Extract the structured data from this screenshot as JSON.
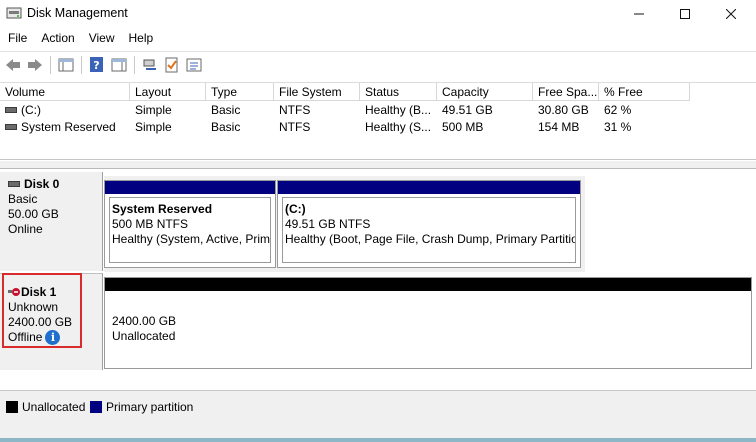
{
  "window": {
    "title": "Disk Management"
  },
  "menu": [
    "File",
    "Action",
    "View",
    "Help"
  ],
  "toolbar": {
    "buttons": [
      "back-icon",
      "forward-icon",
      "console-tree-icon",
      "help-icon",
      "action-pane-icon",
      "connect-icon",
      "check-icon",
      "properties-icon"
    ]
  },
  "volume_table": {
    "columns": [
      "Volume",
      "Layout",
      "Type",
      "File System",
      "Status",
      "Capacity",
      "Free Spa...",
      "% Free"
    ],
    "rows": [
      [
        "(C:)",
        "Simple",
        "Basic",
        "NTFS",
        "Healthy (B...",
        "49.51 GB",
        "30.80 GB",
        "62 %"
      ],
      [
        "System Reserved",
        "Simple",
        "Basic",
        "NTFS",
        "Healthy (S...",
        "500 MB",
        "154 MB",
        "31 %"
      ]
    ]
  },
  "disks": [
    {
      "name": "Disk 0",
      "type": "Basic",
      "size": "50.00 GB",
      "state": "Online",
      "partitions": [
        {
          "name": "System Reserved",
          "size": "500 MB NTFS",
          "status": "Healthy (System, Active, Primary Partition)"
        },
        {
          "name": "(C:)",
          "size": "49.51 GB NTFS",
          "status": "Healthy (Boot, Page File, Crash Dump, Primary Partition)"
        }
      ]
    },
    {
      "name": "Disk 1",
      "type": "Unknown",
      "size": "2400.00 GB",
      "state": "Offline",
      "unallocated": {
        "size": "2400.00 GB",
        "label": "Unallocated"
      }
    }
  ],
  "legend": [
    {
      "label": "Unallocated",
      "color": "#000000"
    },
    {
      "label": "Primary partition",
      "color": "#000080"
    }
  ],
  "colors": {
    "primary": "#000080",
    "unallocated": "#000000",
    "highlight": "#d92b2b",
    "info": "#1f6fce"
  }
}
